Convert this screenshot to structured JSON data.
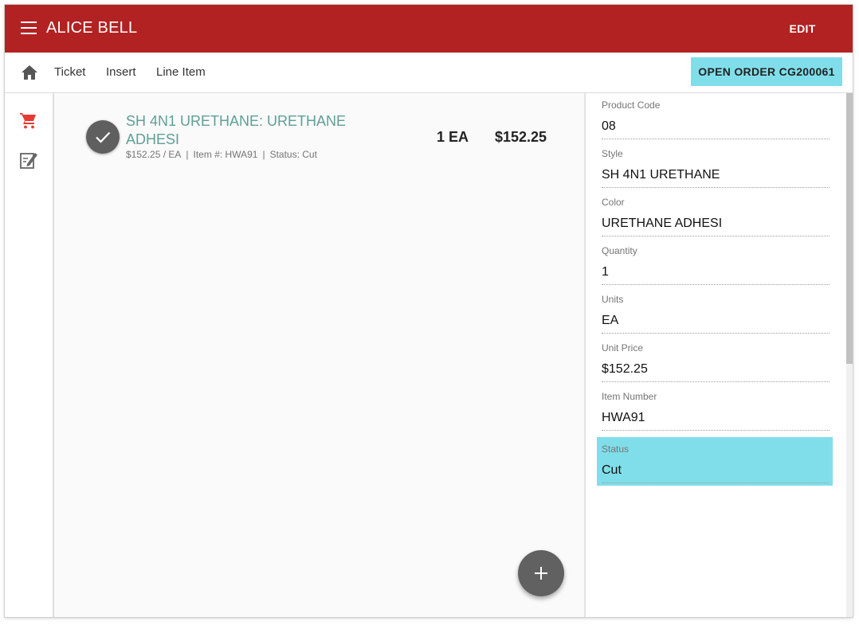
{
  "appbar": {
    "title": "ALICE BELL",
    "edit_label": "EDIT"
  },
  "toolbar": {
    "breadcrumbs": [
      "Ticket",
      "Insert",
      "Line Item"
    ],
    "order_button": "OPEN ORDER CG200061"
  },
  "icons": {
    "menu": "menu-icon",
    "home": "home-icon",
    "cart": "cart-icon",
    "edit_note": "edit-note-icon",
    "check": "check-icon",
    "add": "add-icon"
  },
  "colors": {
    "appbar": "#b22222",
    "accent": "#80deea",
    "item_title": "#5f9f96",
    "cart_icon": "#e53935"
  },
  "line_item": {
    "title": "SH 4N1 URETHANE: URETHANE ADHESI",
    "unit_price": "$152.25 / EA",
    "item_number": "Item #: HWA91",
    "status": "Status: Cut",
    "quantity": "1 EA",
    "total": "$152.25"
  },
  "detail": {
    "fields": [
      {
        "label": "Product Code",
        "value": "08"
      },
      {
        "label": "Style",
        "value": "SH 4N1 URETHANE"
      },
      {
        "label": "Color",
        "value": "URETHANE ADHESI"
      },
      {
        "label": "Quantity",
        "value": "1"
      },
      {
        "label": "Units",
        "value": "EA"
      },
      {
        "label": "Unit Price",
        "value": "$152.25"
      },
      {
        "label": "Item Number",
        "value": "HWA91"
      },
      {
        "label": "Status",
        "value": "Cut"
      }
    ],
    "active_field": "Status"
  }
}
